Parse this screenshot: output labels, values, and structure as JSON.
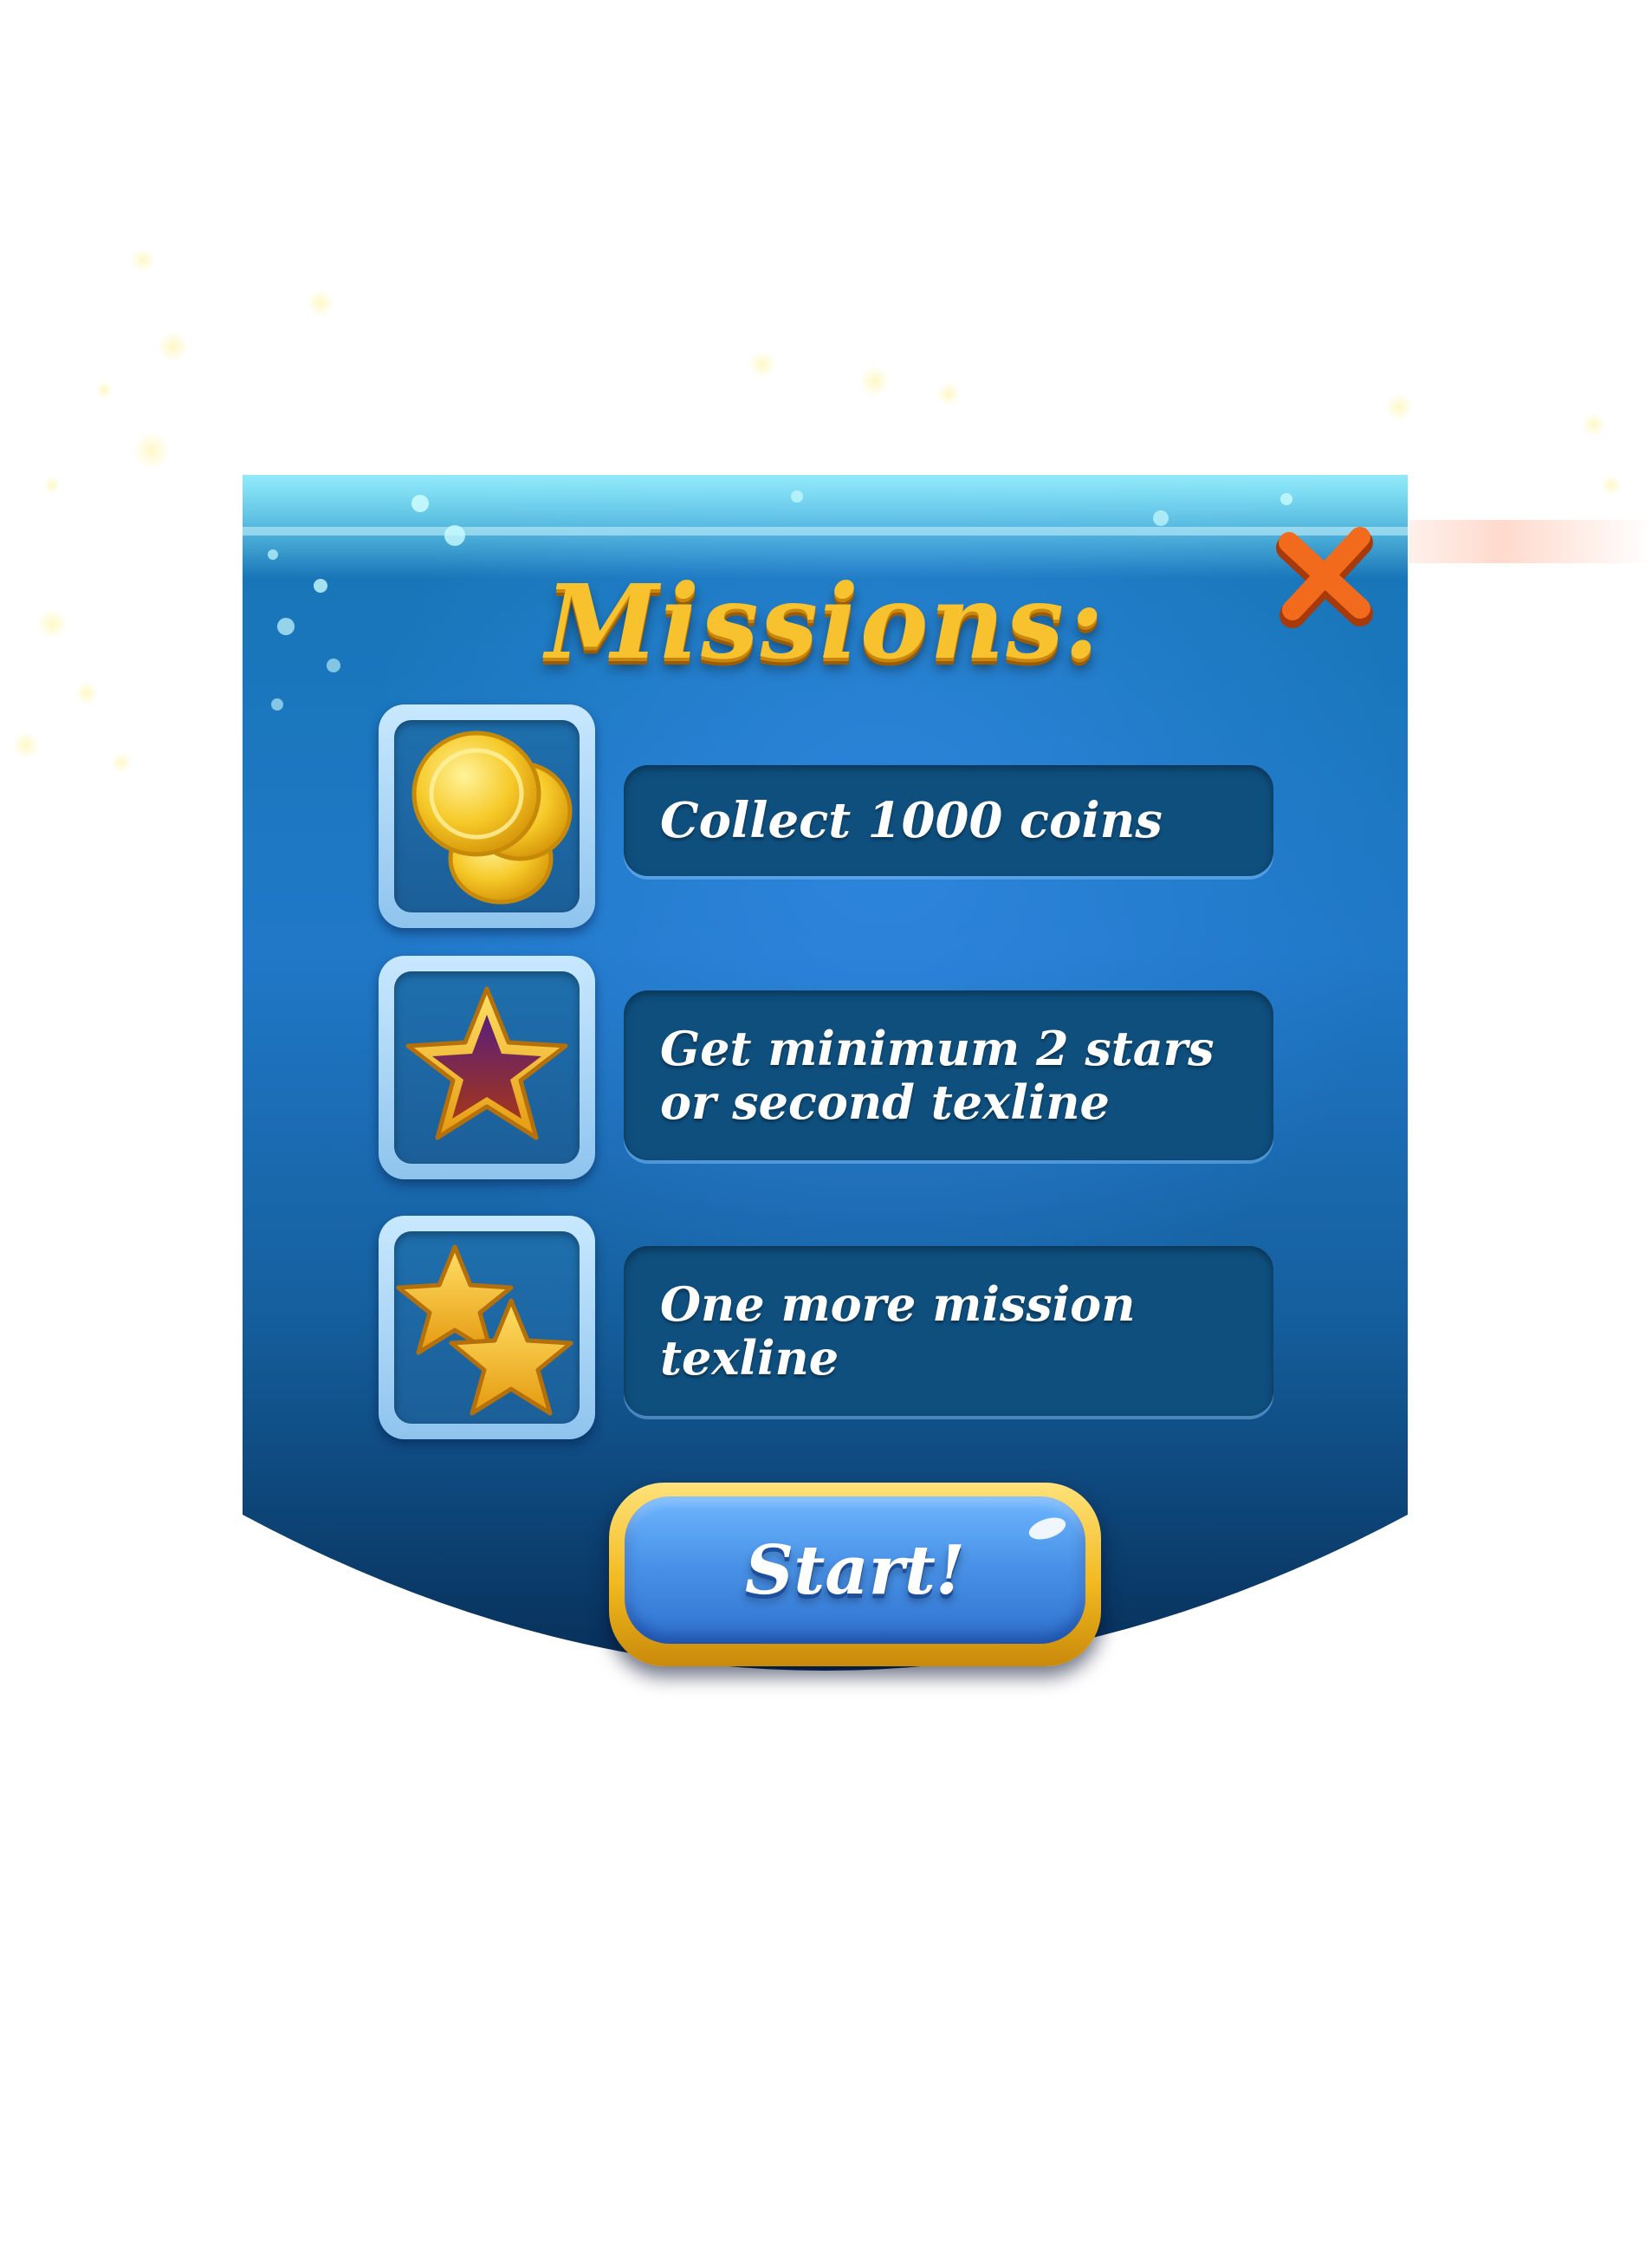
{
  "dialog": {
    "title": "Missions:",
    "close_icon": "close-x-icon",
    "missions": [
      {
        "icon": "gold-coins-icon",
        "text_lines": [
          "Collect 1000 coins"
        ]
      },
      {
        "icon": "purple-star-icon",
        "text_lines": [
          "Get minimum 2 stars",
          "or second texline"
        ]
      },
      {
        "icon": "two-gold-stars-icon",
        "text_lines": [
          "One more mission",
          "texline"
        ]
      }
    ],
    "start_label": "Start!"
  },
  "colors": {
    "panel_top": "#1b6fa6",
    "panel_bottom": "#0a3e6e",
    "title_gold": "#f7c22e",
    "close_orange": "#f26a1b",
    "button_blue": "#4a93e8",
    "button_gold_rim": "#f2b91f"
  }
}
